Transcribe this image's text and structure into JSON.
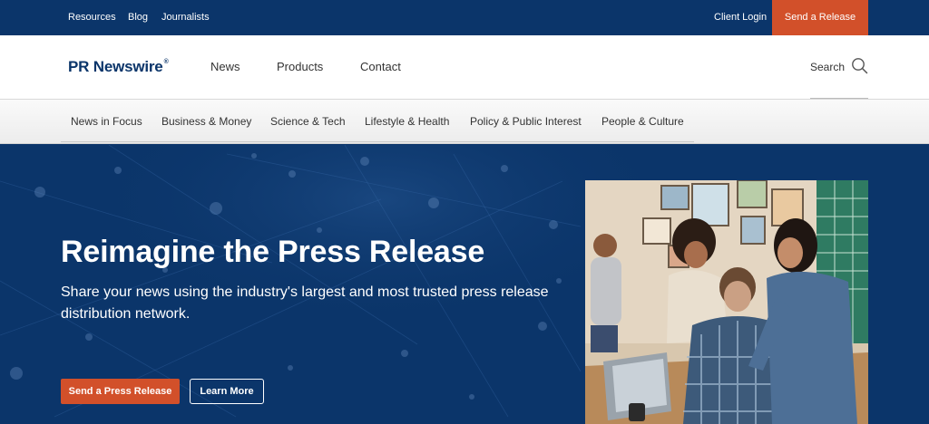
{
  "topbar": {
    "links": [
      "Resources",
      "Blog",
      "Journalists"
    ],
    "client_login": "Client Login",
    "send_release": "Send a Release"
  },
  "header": {
    "logo": "PR Newswire",
    "logo_mark": "®",
    "nav": [
      "News",
      "Products",
      "Contact"
    ],
    "search_label": "Search"
  },
  "categories": [
    "News in Focus",
    "Business & Money",
    "Science & Tech",
    "Lifestyle & Health",
    "Policy & Public Interest",
    "People & Culture"
  ],
  "hero": {
    "title": "Reimagine the Press Release",
    "subtitle": "Share your news using the industry's largest and most trusted press release distribution network.",
    "primary_button": "Send a Press Release",
    "secondary_button": "Learn More"
  },
  "colors": {
    "brand_navy": "#0b356a",
    "accent_orange": "#d2502a"
  }
}
